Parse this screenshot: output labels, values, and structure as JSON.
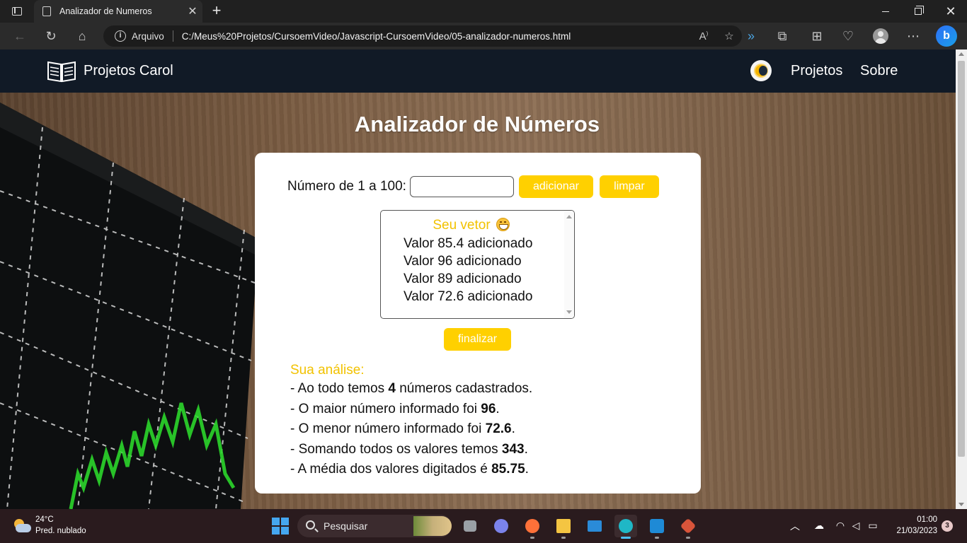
{
  "browser": {
    "tab_title": "Analizador de Numeros",
    "address_scheme": "Arquivo",
    "address_url": "C:/Meus%20Projetos/CursoemVideo/Javascript-CursoemVideo/05-analizador-numeros.html",
    "bing_label": "b"
  },
  "site": {
    "brand": "Projetos Carol",
    "nav": [
      "Projetos",
      "Sobre"
    ]
  },
  "page": {
    "title": "Analizador de Números",
    "input_label": "Número de 1 a 100:",
    "input_value": "",
    "add_button": "adicionar",
    "clear_button": "limpar",
    "vector_heading": "Seu vetor",
    "vector_items": [
      "Valor 85.4 adicionado",
      "Valor 96 adicionado",
      "Valor 89 adicionado",
      "Valor 72.6 adicionado"
    ],
    "finish_button": "finalizar",
    "analysis_title": "Sua análise:",
    "analysis": [
      {
        "pre": "- Ao todo temos ",
        "value": "4",
        "post": " números cadastrados."
      },
      {
        "pre": "- O maior número informado foi ",
        "value": "96",
        "post": "."
      },
      {
        "pre": "- O menor número informado foi ",
        "value": "72.6",
        "post": "."
      },
      {
        "pre": "- Somando todos os valores temos ",
        "value": "343",
        "post": "."
      },
      {
        "pre": "- A média dos valores digitados é ",
        "value": "85.75",
        "post": "."
      }
    ]
  },
  "taskbar": {
    "weather_temp": "24°C",
    "weather_desc": "Pred. nublado",
    "search_label": "Pesquisar",
    "time": "01:00",
    "date": "21/03/2023",
    "notifications": "3"
  },
  "colors": {
    "accent_yellow": "#ffd000",
    "nav_bg": "#111a26"
  }
}
